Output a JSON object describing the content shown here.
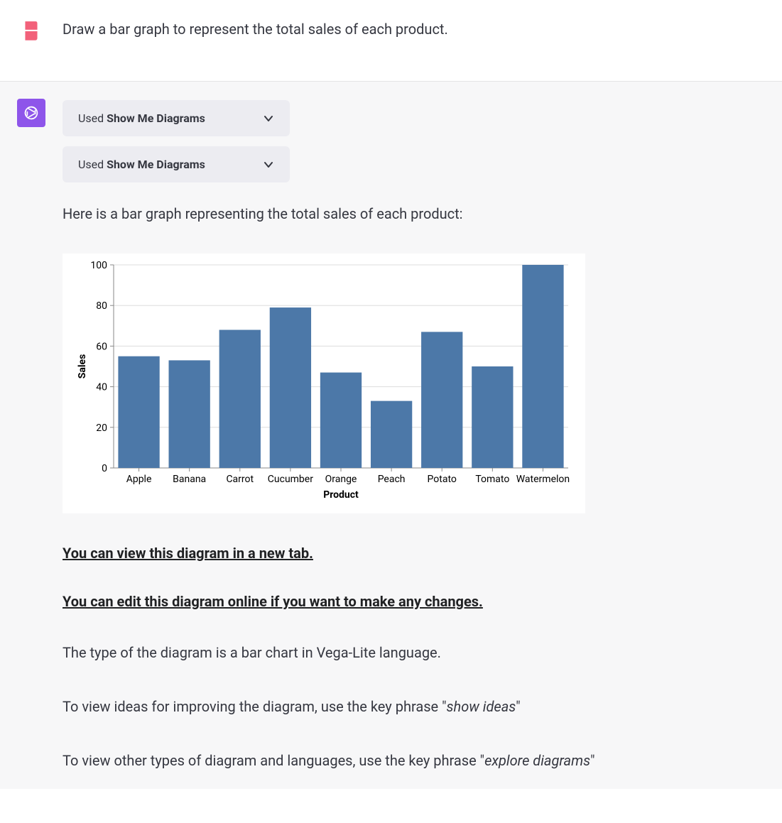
{
  "user": {
    "prompt": "Draw a bar graph to represent the total sales of each product."
  },
  "assistant": {
    "pill_prefix": "Used ",
    "pill_bold": "Show Me Diagrams",
    "intro": "Here is a bar graph representing the total sales of each product:",
    "link_view": "You can view this diagram in a new tab.",
    "link_edit": "You can edit this diagram online if you want to make any changes.",
    "desc_type": "The type of the diagram is a bar chart in Vega-Lite language.",
    "desc_ideas_pre": "To view ideas for improving the diagram, use the key phrase \"",
    "desc_ideas_em": "show ideas",
    "desc_ideas_post": "\"",
    "desc_explore_pre": "To view other types of diagram and languages, use the key phrase \"",
    "desc_explore_em": "explore diagrams",
    "desc_explore_post": "\""
  },
  "chart_data": {
    "type": "bar",
    "categories": [
      "Apple",
      "Banana",
      "Carrot",
      "Cucumber",
      "Orange",
      "Peach",
      "Potato",
      "Tomato",
      "Watermelon"
    ],
    "values": [
      55,
      53,
      68,
      79,
      47,
      33,
      67,
      50,
      100
    ],
    "xlabel": "Product",
    "ylabel": "Sales",
    "ylim": [
      0,
      100
    ],
    "yticks": [
      0,
      20,
      40,
      60,
      80,
      100
    ]
  }
}
